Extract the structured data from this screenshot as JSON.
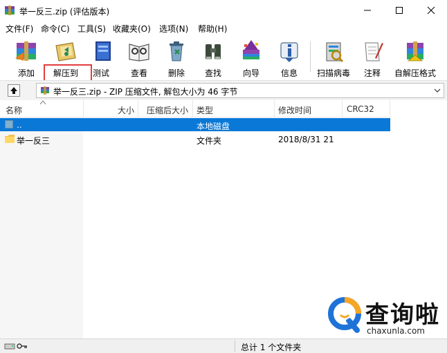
{
  "window": {
    "title": "举一反三.zip (评估版本)"
  },
  "menu": [
    "文件(F)",
    "命令(C)",
    "工具(S)",
    "收藏夹(O)",
    "选项(N)",
    "帮助(H)"
  ],
  "toolbar": {
    "items": [
      {
        "label": "添加",
        "icon": "add-archive-icon"
      },
      {
        "label": "解压到",
        "icon": "extract-to-icon"
      },
      {
        "label": "测试",
        "icon": "test-icon"
      },
      {
        "label": "查看",
        "icon": "view-icon"
      },
      {
        "label": "删除",
        "icon": "delete-icon"
      },
      {
        "label": "查找",
        "icon": "find-icon"
      },
      {
        "label": "向导",
        "icon": "wizard-icon"
      },
      {
        "label": "信息",
        "icon": "info-icon"
      },
      {
        "label": "扫描病毒",
        "icon": "virus-scan-icon"
      },
      {
        "label": "注释",
        "icon": "comment-icon"
      },
      {
        "label": "自解压格式",
        "icon": "sfx-icon"
      }
    ]
  },
  "address": {
    "text": "举一反三.zip - ZIP 压缩文件, 解包大小为 46 字节"
  },
  "columns": [
    "名称",
    "大小",
    "压缩后大小",
    "类型",
    "修改时间",
    "CRC32"
  ],
  "rows": [
    {
      "name": "..",
      "size": "",
      "packed": "",
      "type": "本地磁盘",
      "modified": "",
      "crc": "",
      "selected": true
    },
    {
      "name": "举一反三",
      "size": "",
      "packed": "",
      "type": "文件夹",
      "modified": "2018/8/31 21",
      "crc": "",
      "selected": false
    }
  ],
  "status": {
    "text": "总计 1 个文件夹"
  },
  "watermark": {
    "text": "查询啦",
    "url": "chaxunla.com"
  },
  "colors": {
    "selection": "#0a78d7",
    "highlight_box": "#e23c3c",
    "watermark_orange": "#f5a623",
    "watermark_blue": "#1e73d8"
  }
}
